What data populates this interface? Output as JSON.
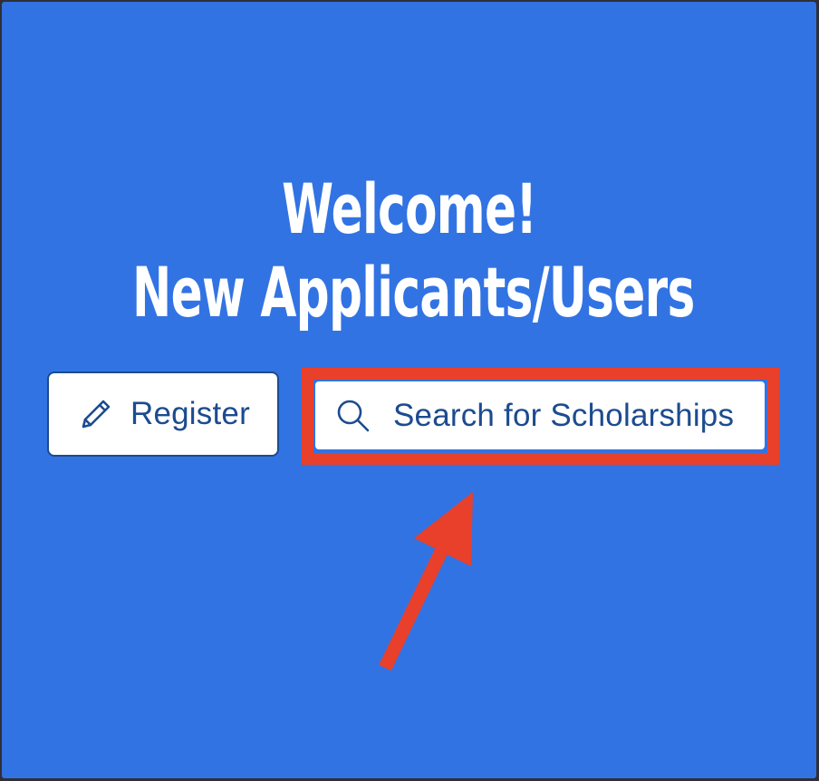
{
  "hero": {
    "title_line1": "Welcome!",
    "title_line2": "New Applicants/Users"
  },
  "actions": {
    "register_label": "Register",
    "register_icon": "pencil-icon",
    "search_label": "Search for Scholarships",
    "search_icon": "search-icon"
  },
  "annotation": {
    "highlight_color": "#e8402a",
    "arrow_color": "#e8402a"
  },
  "colors": {
    "background": "#3273e3",
    "button_text": "#1c4b8f",
    "button_bg": "#ffffff"
  }
}
